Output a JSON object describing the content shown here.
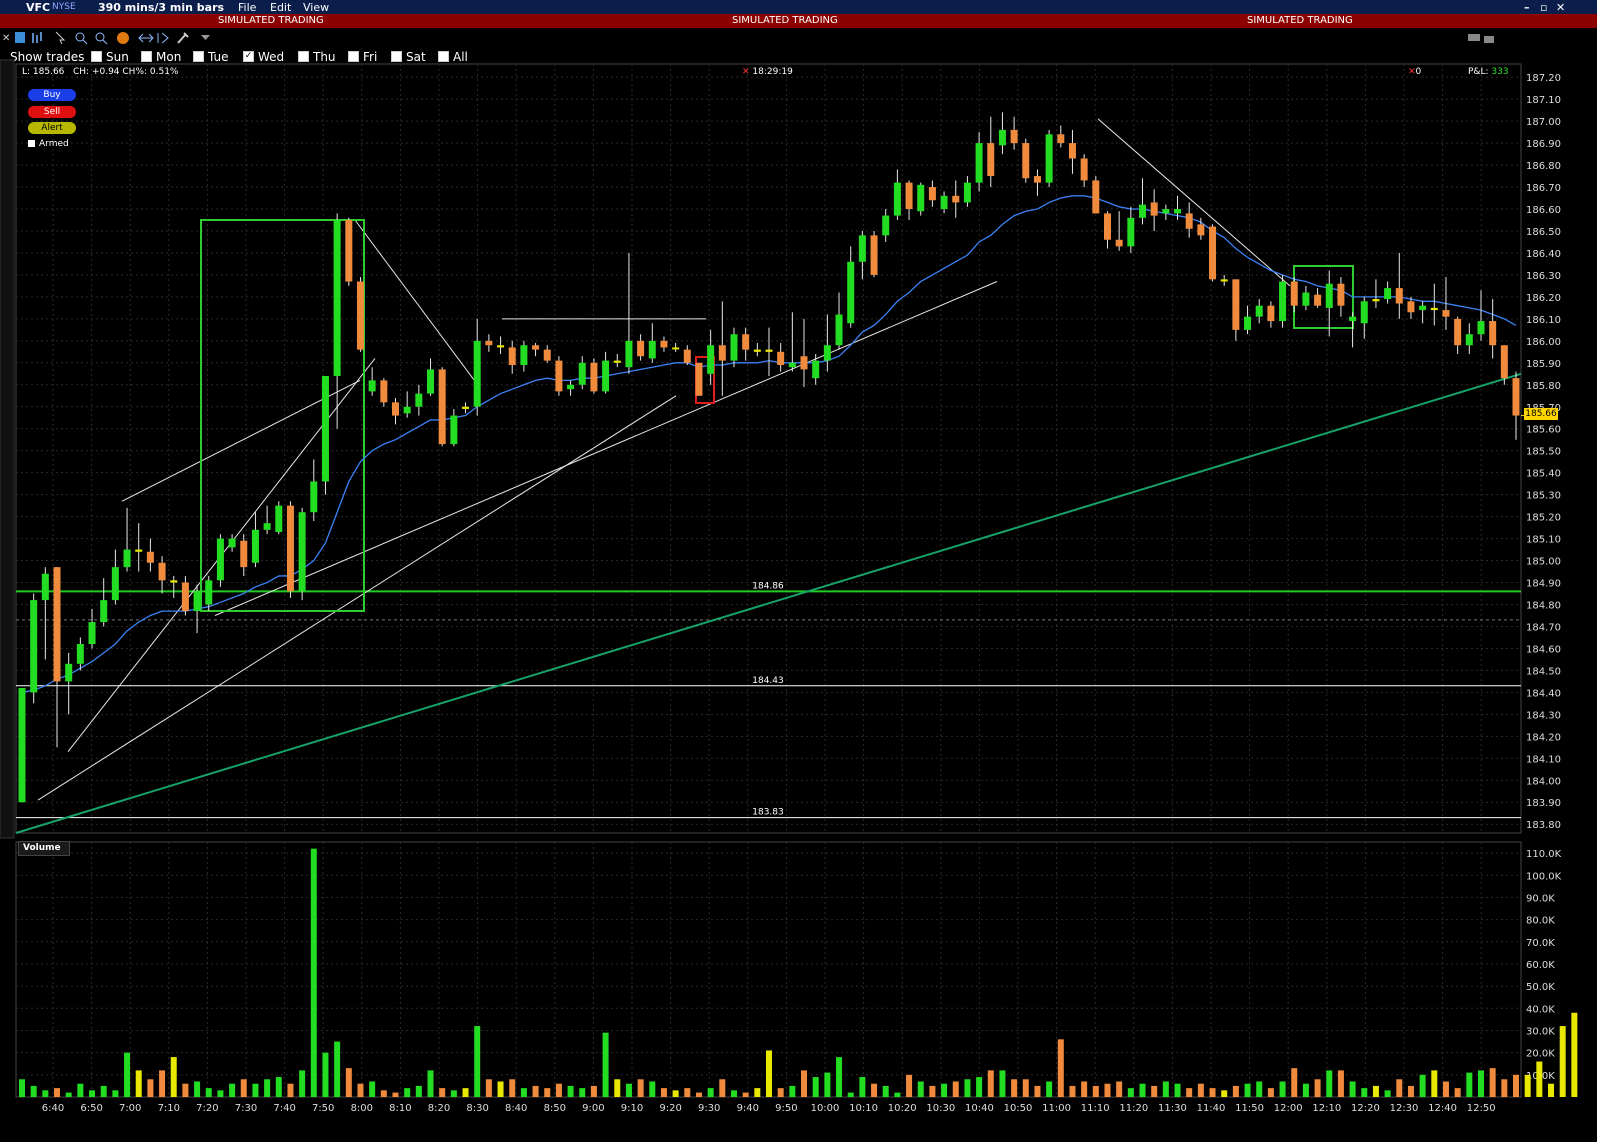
{
  "window": {
    "symbol": "VFC",
    "exchange": "NYSE",
    "period": "390 mins/3 min bars",
    "menu": [
      "File",
      "Edit",
      "View"
    ]
  },
  "banner": {
    "text": "SIMULATED TRADING"
  },
  "trades_row": {
    "label": "Show trades",
    "days": [
      {
        "label": "Sun",
        "checked": false
      },
      {
        "label": "Mon",
        "checked": false
      },
      {
        "label": "Tue",
        "checked": false
      },
      {
        "label": "Wed",
        "checked": true
      },
      {
        "label": "Thu",
        "checked": false
      },
      {
        "label": "Fri",
        "checked": false
      },
      {
        "label": "Sat",
        "checked": false
      },
      {
        "label": "All",
        "checked": false
      }
    ]
  },
  "info": {
    "last": "L: 185.66",
    "change": "CH: +0.94 CH%: 0.51%",
    "time": "18:29:19",
    "position": "0",
    "pnl_label": "P&L:",
    "pnl_value": "333"
  },
  "order_buttons": {
    "buy": "Buy",
    "sell": "Sell",
    "alert": "Alert",
    "armed": "Armed"
  },
  "volume_panel": {
    "title": "Volume"
  },
  "colors": {
    "up": "#22dd22",
    "down": "#f08a3c",
    "doji": "#e8e800",
    "ema": "#3b82f6",
    "levels": "#22cc22"
  },
  "chart_data": {
    "type": "candlestick",
    "y_axis": {
      "ticks": [
        "187.20",
        "187.10",
        "187.00",
        "186.90",
        "186.80",
        "186.70",
        "186.60",
        "186.50",
        "186.40",
        "186.30",
        "186.20",
        "186.10",
        "186.00",
        "185.90",
        "185.80",
        "185.70",
        "185.60",
        "185.50",
        "185.40",
        "185.30",
        "185.20",
        "185.10",
        "185.00",
        "184.90",
        "184.80",
        "184.70",
        "184.60",
        "184.50",
        "184.40",
        "184.30",
        "184.20",
        "184.10",
        "184.00",
        "183.90",
        "183.80"
      ],
      "range": [
        183.76,
        187.26
      ]
    },
    "x_axis": {
      "ticks": [
        "6:40",
        "6:50",
        "7:00",
        "7:10",
        "7:20",
        "7:30",
        "7:40",
        "7:50",
        "8:00",
        "8:10",
        "8:20",
        "8:30",
        "8:40",
        "8:50",
        "9:00",
        "9:10",
        "9:20",
        "9:30",
        "9:40",
        "9:50",
        "10:00",
        "10:10",
        "10:20",
        "10:30",
        "10:40",
        "10:50",
        "11:00",
        "11:10",
        "11:20",
        "11:30",
        "11:40",
        "11:50",
        "12:00",
        "12:10",
        "12:20",
        "12:30",
        "12:40",
        "12:50"
      ]
    },
    "last_price": "185.66",
    "horizontal_levels": [
      {
        "label": "184.86",
        "price": 184.86,
        "color": "#22cc22"
      },
      {
        "label": "184.43",
        "price": 184.43,
        "color": "#ffffff"
      },
      {
        "label": "183.83",
        "price": 183.83,
        "color": "#ffffff"
      }
    ],
    "volume_axis": {
      "ticks": [
        "110.0K",
        "100.0K",
        "90.0K",
        "80.0K",
        "70.0K",
        "60.0K",
        "50.0K",
        "40.0K",
        "30.0K",
        "20.0K",
        "10.0K"
      ],
      "max": 115000
    },
    "candles": [
      [
        183.9,
        184.42,
        183.9,
        184.42
      ],
      [
        184.4,
        184.82,
        184.35,
        184.85
      ],
      [
        184.82,
        184.94,
        184.55,
        184.97
      ],
      [
        184.97,
        184.45,
        184.15,
        184.97
      ],
      [
        184.45,
        184.53,
        184.3,
        184.58
      ],
      [
        184.53,
        184.62,
        184.5,
        184.65
      ],
      [
        184.62,
        184.72,
        184.6,
        184.78
      ],
      [
        184.72,
        184.82,
        184.7,
        184.92
      ],
      [
        184.82,
        184.97,
        184.8,
        185.05
      ],
      [
        184.97,
        185.05,
        184.95,
        185.24
      ],
      [
        185.05,
        185.04,
        184.95,
        185.17
      ],
      [
        185.04,
        184.99,
        184.95,
        185.1
      ],
      [
        184.99,
        184.91,
        184.85,
        185.02
      ],
      [
        184.91,
        184.9,
        184.83,
        184.93
      ],
      [
        184.9,
        184.77,
        184.75,
        184.93
      ],
      [
        184.77,
        184.86,
        184.67,
        184.89
      ],
      [
        184.8,
        184.91,
        184.77,
        184.93
      ],
      [
        184.91,
        185.1,
        184.88,
        185.12
      ],
      [
        185.06,
        185.1,
        185.04,
        185.12
      ],
      [
        185.09,
        184.97,
        184.93,
        185.12
      ],
      [
        184.99,
        185.14,
        184.97,
        185.22
      ],
      [
        185.14,
        185.17,
        185.12,
        185.25
      ],
      [
        185.13,
        185.25,
        185.12,
        185.27
      ],
      [
        185.25,
        184.86,
        184.83,
        185.27
      ],
      [
        184.86,
        185.22,
        184.82,
        185.24
      ],
      [
        185.22,
        185.36,
        185.18,
        185.46
      ],
      [
        185.36,
        185.84,
        185.3,
        185.84
      ],
      [
        185.84,
        186.55,
        185.6,
        186.58
      ],
      [
        186.55,
        186.27,
        186.25,
        186.56
      ],
      [
        186.27,
        185.96,
        185.95,
        186.29
      ],
      [
        185.77,
        185.82,
        185.75,
        185.88
      ],
      [
        185.82,
        185.72,
        185.7,
        185.83
      ],
      [
        185.72,
        185.66,
        185.62,
        185.74
      ],
      [
        185.67,
        185.7,
        185.65,
        185.77
      ],
      [
        185.7,
        185.76,
        185.66,
        185.8
      ],
      [
        185.76,
        185.87,
        185.75,
        185.92
      ],
      [
        185.87,
        185.53,
        185.52,
        185.88
      ],
      [
        185.53,
        185.66,
        185.52,
        185.69
      ],
      [
        185.69,
        185.7,
        185.67,
        185.72
      ],
      [
        185.7,
        186.0,
        185.66,
        186.1
      ],
      [
        186.0,
        185.98,
        185.95,
        186.03
      ],
      [
        185.98,
        185.97,
        185.94,
        186.02
      ],
      [
        185.97,
        185.89,
        185.85,
        186.0
      ],
      [
        185.89,
        185.98,
        185.86,
        186.0
      ],
      [
        185.98,
        185.96,
        185.93,
        185.99
      ],
      [
        185.96,
        185.91,
        185.9,
        185.98
      ],
      [
        185.91,
        185.77,
        185.75,
        185.93
      ],
      [
        185.78,
        185.8,
        185.75,
        185.82
      ],
      [
        185.8,
        185.9,
        185.78,
        185.93
      ],
      [
        185.9,
        185.77,
        185.76,
        185.92
      ],
      [
        185.77,
        185.91,
        185.76,
        185.95
      ],
      [
        185.9,
        185.91,
        185.88,
        185.94
      ],
      [
        185.88,
        186.0,
        185.85,
        186.4
      ],
      [
        186.0,
        185.93,
        185.91,
        186.03
      ],
      [
        185.92,
        186.0,
        185.9,
        186.08
      ],
      [
        186.0,
        185.97,
        185.95,
        186.02
      ],
      [
        185.97,
        185.97,
        185.95,
        185.99
      ],
      [
        185.96,
        185.9,
        185.89,
        185.98
      ],
      [
        185.9,
        185.75,
        185.75,
        185.9
      ],
      [
        185.85,
        185.98,
        185.8,
        186.05
      ],
      [
        185.98,
        185.91,
        185.75,
        186.18
      ],
      [
        185.91,
        186.03,
        185.88,
        186.06
      ],
      [
        186.03,
        185.96,
        185.91,
        186.06
      ],
      [
        185.96,
        185.95,
        185.93,
        185.99
      ],
      [
        185.96,
        185.95,
        185.84,
        186.06
      ],
      [
        185.95,
        185.89,
        185.86,
        185.99
      ],
      [
        185.88,
        185.9,
        185.86,
        186.13
      ],
      [
        185.93,
        185.87,
        185.79,
        186.1
      ],
      [
        185.83,
        185.91,
        185.8,
        185.94
      ],
      [
        185.91,
        185.98,
        185.86,
        186.12
      ],
      [
        185.98,
        186.12,
        185.96,
        186.22
      ],
      [
        186.08,
        186.36,
        186.06,
        186.43
      ],
      [
        186.36,
        186.48,
        186.28,
        186.5
      ],
      [
        186.48,
        186.3,
        186.29,
        186.5
      ],
      [
        186.48,
        186.57,
        186.45,
        186.6
      ],
      [
        186.57,
        186.72,
        186.55,
        186.78
      ],
      [
        186.72,
        186.6,
        186.55,
        186.73
      ],
      [
        186.59,
        186.71,
        186.57,
        186.72
      ],
      [
        186.7,
        186.64,
        186.61,
        186.73
      ],
      [
        186.6,
        186.66,
        186.58,
        186.68
      ],
      [
        186.66,
        186.63,
        186.56,
        186.73
      ],
      [
        186.63,
        186.72,
        186.61,
        186.75
      ],
      [
        186.72,
        186.9,
        186.68,
        186.95
      ],
      [
        186.9,
        186.75,
        186.7,
        187.02
      ],
      [
        186.89,
        186.96,
        186.85,
        187.04
      ],
      [
        186.96,
        186.9,
        186.87,
        187.02
      ],
      [
        186.9,
        186.74,
        186.72,
        186.92
      ],
      [
        186.75,
        186.72,
        186.66,
        186.78
      ],
      [
        186.72,
        186.94,
        186.7,
        186.96
      ],
      [
        186.94,
        186.9,
        186.88,
        186.98
      ],
      [
        186.9,
        186.83,
        186.76,
        186.96
      ],
      [
        186.83,
        186.73,
        186.7,
        186.85
      ],
      [
        186.73,
        186.58,
        186.58,
        186.75
      ],
      [
        186.58,
        186.46,
        186.42,
        186.59
      ],
      [
        186.46,
        186.43,
        186.41,
        186.59
      ],
      [
        186.43,
        186.56,
        186.4,
        186.61
      ],
      [
        186.56,
        186.62,
        186.53,
        186.74
      ],
      [
        186.63,
        186.57,
        186.5,
        186.69
      ],
      [
        186.58,
        186.6,
        186.55,
        186.62
      ],
      [
        186.58,
        186.6,
        186.55,
        186.66
      ],
      [
        186.58,
        186.51,
        186.47,
        186.63
      ],
      [
        186.53,
        186.48,
        186.46,
        186.56
      ],
      [
        186.52,
        186.28,
        186.27,
        186.53
      ],
      [
        186.27,
        186.28,
        186.25,
        186.3
      ],
      [
        186.28,
        186.05,
        186.0,
        186.28
      ],
      [
        186.05,
        186.11,
        186.03,
        186.16
      ],
      [
        186.11,
        186.16,
        186.08,
        186.19
      ],
      [
        186.16,
        186.09,
        186.06,
        186.18
      ],
      [
        186.09,
        186.27,
        186.06,
        186.3
      ],
      [
        186.27,
        186.16,
        186.13,
        186.29
      ],
      [
        186.16,
        186.22,
        186.14,
        186.25
      ],
      [
        186.21,
        186.16,
        186.15,
        186.24
      ],
      [
        186.15,
        186.26,
        186.02,
        186.32
      ],
      [
        186.26,
        186.16,
        186.11,
        186.29
      ],
      [
        186.09,
        186.11,
        185.97,
        186.13
      ],
      [
        186.08,
        186.18,
        186.01,
        186.2
      ],
      [
        186.18,
        186.19,
        186.15,
        186.28
      ],
      [
        186.19,
        186.24,
        186.17,
        186.27
      ],
      [
        186.24,
        186.17,
        186.1,
        186.4
      ],
      [
        186.18,
        186.13,
        186.1,
        186.2
      ],
      [
        186.14,
        186.16,
        186.08,
        186.18
      ],
      [
        186.15,
        186.14,
        186.07,
        186.26
      ],
      [
        186.14,
        186.11,
        186.05,
        186.29
      ],
      [
        186.1,
        185.98,
        185.94,
        186.11
      ],
      [
        185.98,
        186.03,
        185.94,
        186.08
      ],
      [
        186.03,
        186.09,
        186.0,
        186.23
      ],
      [
        186.09,
        185.98,
        185.92,
        186.19
      ],
      [
        185.98,
        185.83,
        185.8,
        185.98
      ],
      [
        185.83,
        185.66,
        185.55,
        185.86
      ]
    ],
    "ema": [
      184.4,
      184.41,
      184.43,
      184.46,
      184.48,
      184.51,
      184.54,
      184.58,
      184.62,
      184.68,
      184.72,
      184.75,
      184.77,
      184.77,
      184.77,
      184.78,
      184.79,
      184.81,
      184.83,
      184.85,
      184.88,
      184.9,
      184.93,
      184.93,
      184.96,
      185.0,
      185.08,
      185.22,
      185.36,
      185.45,
      185.5,
      185.53,
      185.55,
      185.58,
      185.61,
      185.64,
      185.64,
      185.65,
      185.66,
      185.7,
      185.73,
      185.76,
      185.78,
      185.8,
      185.82,
      185.83,
      185.82,
      185.82,
      185.83,
      185.83,
      185.84,
      185.85,
      185.86,
      185.87,
      185.88,
      185.89,
      185.9,
      185.9,
      185.88,
      185.89,
      185.89,
      185.9,
      185.9,
      185.9,
      185.91,
      185.9,
      185.9,
      185.9,
      185.9,
      185.91,
      185.93,
      185.98,
      186.04,
      186.07,
      186.12,
      186.18,
      186.22,
      186.27,
      186.3,
      186.33,
      186.36,
      186.39,
      186.45,
      186.48,
      186.53,
      186.57,
      186.59,
      186.6,
      186.63,
      186.65,
      186.66,
      186.66,
      186.65,
      186.63,
      186.61,
      186.6,
      186.6,
      186.59,
      186.58,
      186.57,
      186.56,
      186.54,
      186.5,
      186.47,
      186.42,
      186.38,
      186.35,
      186.32,
      186.3,
      186.28,
      186.27,
      186.25,
      186.24,
      186.23,
      186.2,
      186.2,
      186.2,
      186.2,
      186.2,
      186.19,
      186.18,
      186.18,
      186.17,
      186.16,
      186.15,
      186.14,
      186.12,
      186.1,
      186.07
    ],
    "volume": [
      8000,
      5000,
      3000,
      4000,
      2000,
      6000,
      3000,
      5000,
      3000,
      20000,
      12000,
      8000,
      12000,
      18000,
      6000,
      7000,
      4000,
      3000,
      6000,
      8000,
      6000,
      8000,
      9000,
      6000,
      12000,
      112000,
      20000,
      25000,
      13000,
      6000,
      7000,
      3000,
      2000,
      4000,
      5000,
      12000,
      4000,
      3000,
      4000,
      32000,
      8000,
      7000,
      8000,
      4000,
      5000,
      4000,
      6000,
      5000,
      4000,
      5000,
      29000,
      8000,
      6000,
      8000,
      7000,
      4000,
      3000,
      4000,
      2000,
      4000,
      8000,
      3000,
      2000,
      4000,
      21000,
      4000,
      5000,
      12000,
      9000,
      11000,
      18000,
      2000,
      9000,
      6000,
      5000,
      2000,
      10000,
      7000,
      5000,
      6000,
      7000,
      8000,
      9000,
      12000,
      12000,
      8000,
      8000,
      5000,
      7000,
      26000,
      5000,
      7000,
      5000,
      6000,
      7000,
      4000,
      6000,
      5000,
      7000,
      6000,
      4000,
      6000,
      4000,
      3000,
      5000,
      6000,
      7000,
      4000,
      7000,
      13000,
      6000,
      8000,
      12000,
      12000,
      7000,
      4000,
      5000,
      3000,
      8000,
      5000,
      10000,
      12000,
      7000,
      4000,
      11000,
      12000,
      13000,
      8000,
      10000,
      10000,
      16000,
      6000,
      32000,
      38000
    ]
  }
}
